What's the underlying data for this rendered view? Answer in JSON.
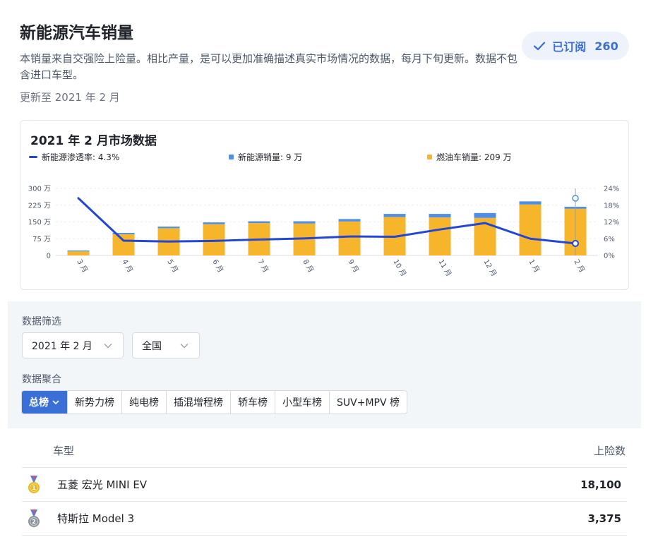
{
  "header": {
    "title": "新能源汽车销量",
    "description": "本销量来自交强险上险量。相比产量，是可以更加准确描述真实市场情况的数据，每月下旬更新。数据不包含进口车型。",
    "updated": "更新至 2021 年 2 月"
  },
  "subscribe": {
    "label": "已订阅",
    "count": "260",
    "icon": "check-icon"
  },
  "chart": {
    "title": "2021 年 2 月市场数据",
    "legend": {
      "penetration": "新能源渗透率: 4.3%",
      "nev": "新能源销量: 9 万",
      "fuel": "燃油车销量: 209 万"
    }
  },
  "chart_data": {
    "type": "bar",
    "categories": [
      "3 月",
      "4 月",
      "5 月",
      "6 月",
      "7 月",
      "8 月",
      "9 月",
      "10 月",
      "11 月",
      "12 月",
      "1 月",
      "2 月"
    ],
    "series": [
      {
        "name": "燃油车销量",
        "kind": "bar",
        "stack": "sales",
        "axis": "left",
        "color": "#f7b52c",
        "values": [
          18,
          95,
          122,
          140,
          145,
          143,
          152,
          172,
          170,
          168,
          228,
          209
        ]
      },
      {
        "name": "新能源销量",
        "kind": "bar",
        "stack": "sales",
        "axis": "left",
        "color": "#4f8fe8",
        "values": [
          4,
          6,
          7,
          8,
          8,
          10,
          11,
          14,
          16,
          22,
          14,
          9
        ]
      },
      {
        "name": "新能源渗透率",
        "kind": "line",
        "axis": "right",
        "color": "#2247d6",
        "values": [
          20.5,
          5.3,
          5.0,
          5.2,
          5.7,
          6.1,
          6.8,
          6.7,
          9.3,
          11.6,
          6.0,
          4.3
        ]
      }
    ],
    "y_left": {
      "ticks": [
        "0",
        "75 万",
        "150 万",
        "225 万",
        "300 万"
      ],
      "values": [
        0,
        75,
        150,
        225,
        300
      ],
      "ylim": [
        0,
        300
      ]
    },
    "y_right": {
      "ticks": [
        "0%",
        "6%",
        "12%",
        "18%",
        "24%"
      ],
      "values": [
        0,
        6,
        12,
        18,
        24
      ],
      "ylim": [
        0,
        24
      ]
    },
    "grid": true,
    "highlight_index": 11
  },
  "filters": {
    "section_label": "数据筛选",
    "month": "2021 年 2 月",
    "region": "全国"
  },
  "aggregation": {
    "section_label": "数据聚合",
    "tabs": [
      "总榜",
      "新势力榜",
      "纯电榜",
      "插混增程榜",
      "轿车榜",
      "小型车榜",
      "SUV+MPV 榜"
    ],
    "active": 0
  },
  "table": {
    "col_model": "车型",
    "col_count": "上险数",
    "rows": [
      {
        "model": "五菱 宏光 MINI EV",
        "count": "18,100",
        "medal": "gold-medal-icon",
        "medal_color": "#e8b923"
      },
      {
        "model": "特斯拉 Model 3",
        "count": "3,375",
        "medal": "silver-medal-icon",
        "medal_color": "#8c939d"
      }
    ]
  }
}
